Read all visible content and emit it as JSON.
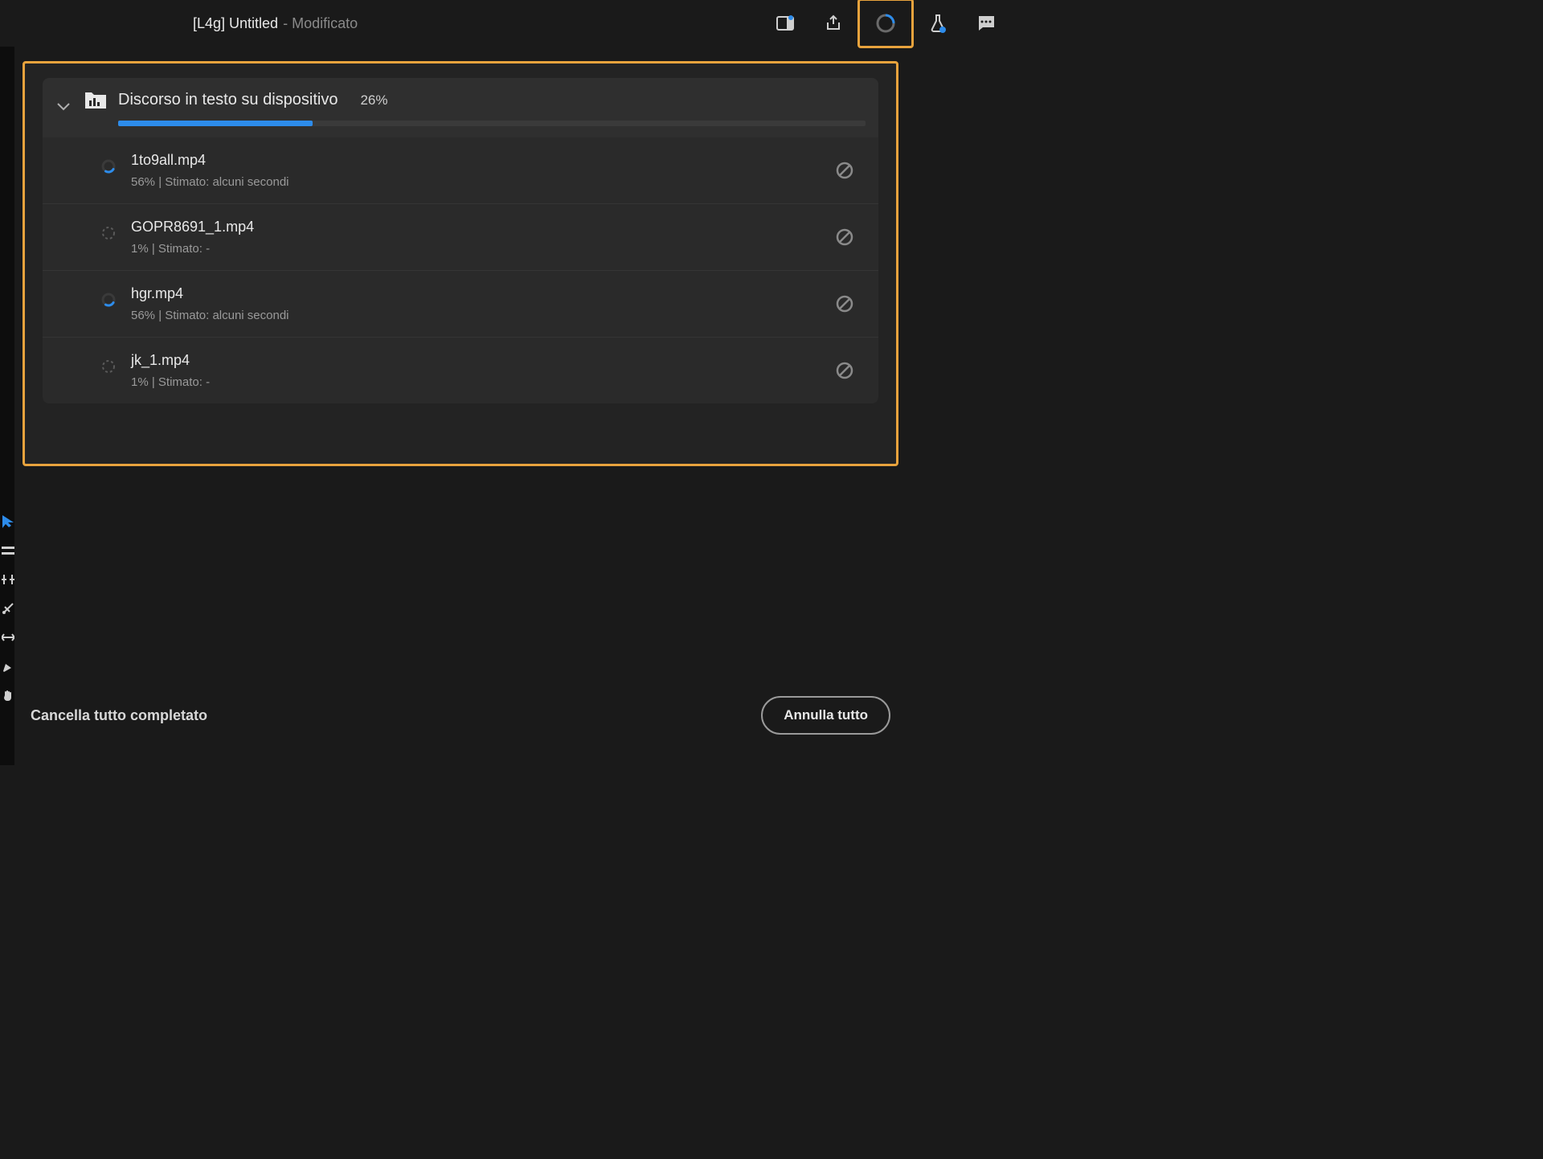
{
  "header": {
    "title_prefix": "[L4g] Untitled",
    "title_suffix": "- Modificato"
  },
  "panel": {
    "title": "Discorso in testo su dispositivo",
    "percent": "26%",
    "progress_width": "26%",
    "items": [
      {
        "name": "1to9all.mp4",
        "meta": "56%  |  Stimato: alcuni secondi",
        "active": true
      },
      {
        "name": "GOPR8691_1.mp4",
        "meta": "1%  |  Stimato: -",
        "active": false
      },
      {
        "name": "hgr.mp4",
        "meta": "56%  |  Stimato: alcuni secondi",
        "active": true
      },
      {
        "name": "jk_1.mp4",
        "meta": "1%  |  Stimato: -",
        "active": false
      }
    ]
  },
  "footer": {
    "clear_label": "Cancella tutto completato",
    "cancel_label": "Annulla tutto"
  }
}
